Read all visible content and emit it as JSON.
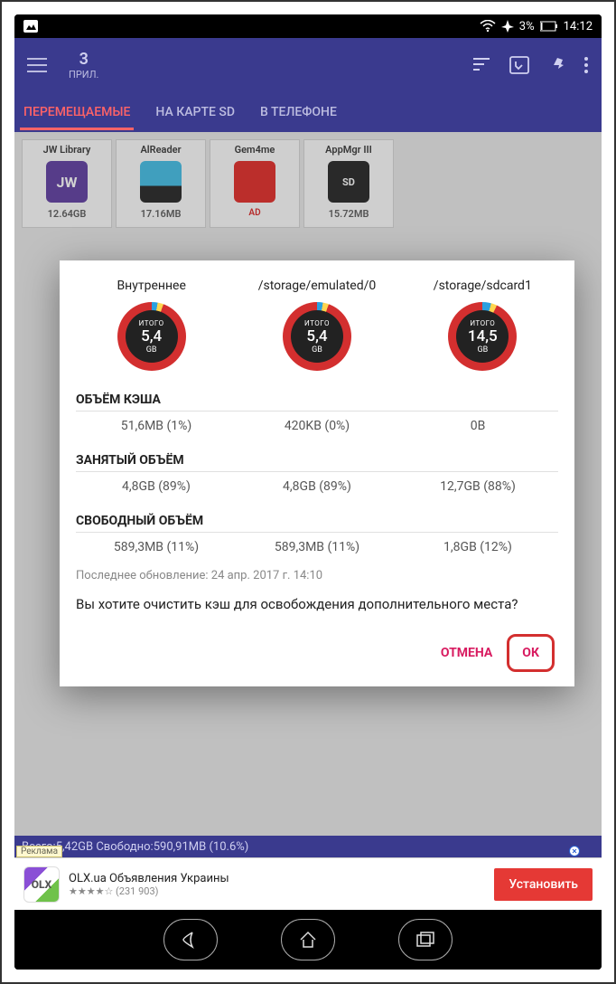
{
  "statusbar": {
    "battery": "3%",
    "time": "14:12"
  },
  "header": {
    "count": "3",
    "count_label": "ПРИЛ."
  },
  "tabs": {
    "movable": "ПЕРЕМЕЩАЕМЫЕ",
    "onsd": "НА КАРТЕ SD",
    "onphone": "В ТЕЛЕФОНЕ"
  },
  "apps": [
    {
      "name": "JW Library",
      "size": "12.64GB",
      "icon_bg": "#6a4aa8",
      "icon_text": "JW"
    },
    {
      "name": "AlReader",
      "size": "17.16MB",
      "icon_bg": "#4fc3e8",
      "icon_text": ""
    },
    {
      "name": "Gem4me",
      "size": "AD",
      "icon_bg": "#e53935",
      "icon_text": ""
    },
    {
      "name": "AppMgr III",
      "size": "15.72MB",
      "icon_bg": "#333",
      "icon_text": "SD"
    }
  ],
  "dialog": {
    "storages": [
      {
        "title": "Внутреннее",
        "label": "ИТОГО",
        "value": "5,4",
        "unit": "GB"
      },
      {
        "title": "/storage/emulated/0",
        "label": "ИТОГО",
        "value": "5,4",
        "unit": "GB"
      },
      {
        "title": "/storage/sdcard1",
        "label": "ИТОГО",
        "value": "14,5",
        "unit": "GB"
      }
    ],
    "cache_title": "ОБЪЁМ КЭША",
    "cache": [
      "51,6MB (1%)",
      "420KB (0%)",
      "0B"
    ],
    "used_title": "ЗАНЯТЫЙ ОБЪЁМ",
    "used": [
      "4,8GB (89%)",
      "4,8GB (89%)",
      "12,7GB (88%)"
    ],
    "free_title": "СВОБОДНЫЙ ОБЪЁМ",
    "free": [
      "589,3MB (11%)",
      "589,3MB (11%)",
      "1,8GB (12%)"
    ],
    "last_update": "Последнее обновление: 24 апр. 2017 г. 14:10",
    "question": "Вы хотите очистить кэш для освобождения дополнительного места?",
    "cancel": "ОТМЕНА",
    "ok": "ОК"
  },
  "status_strip": "Всего:5,42GB Свободно:590,91MB (10.6%)",
  "ad": {
    "label": "Реклама",
    "title": "OLX.ua Объявления Украины",
    "rating": "★★★★☆ (231 903)",
    "install": "Установить",
    "logo": "OLX"
  }
}
